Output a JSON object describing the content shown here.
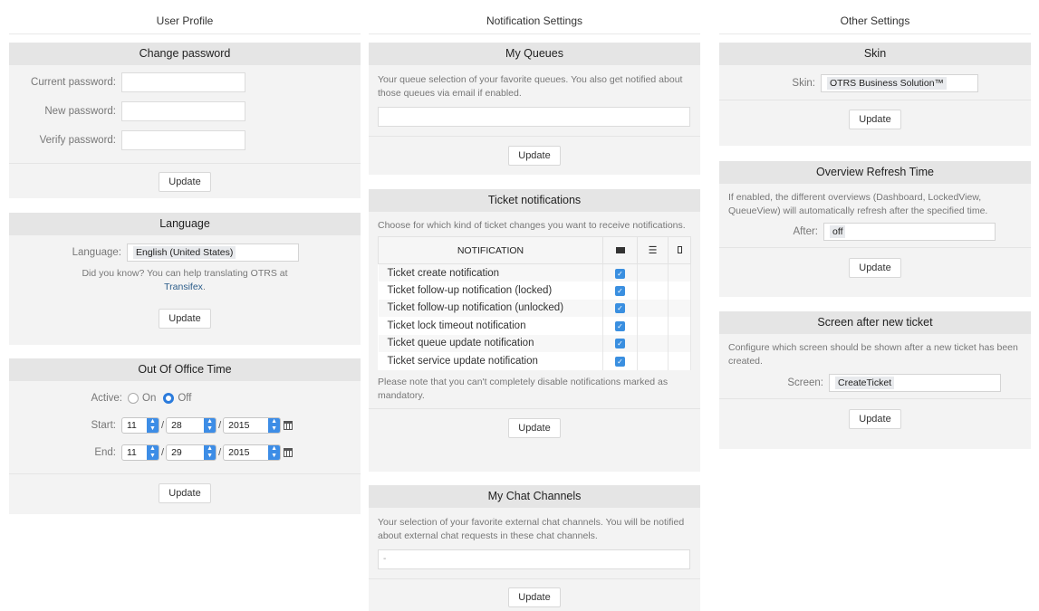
{
  "columns": {
    "user_profile": "User Profile",
    "notification_settings": "Notification Settings",
    "other_settings": "Other Settings"
  },
  "update_label": "Update",
  "change_password": {
    "title": "Change password",
    "current_label": "Current password:",
    "new_label": "New password:",
    "verify_label": "Verify password:"
  },
  "language": {
    "title": "Language",
    "label": "Language:",
    "value": "English (United States)",
    "hint": "Did you know? You can help translating OTRS at",
    "link": "Transifex",
    "hint_end": "."
  },
  "out_of_office": {
    "title": "Out Of Office Time",
    "active_label": "Active:",
    "on_label": "On",
    "off_label": "Off",
    "start_label": "Start:",
    "end_label": "End:",
    "start": {
      "month": "11",
      "day": "28",
      "year": "2015"
    },
    "end": {
      "month": "11",
      "day": "29",
      "year": "2015"
    }
  },
  "my_queues": {
    "title": "My Queues",
    "description": "Your queue selection of your favorite queues. You also get notified about those queues via email if enabled."
  },
  "ticket_notifications": {
    "title": "Ticket notifications",
    "description": "Choose for which kind of ticket changes you want to receive notifications.",
    "header": "NOTIFICATION",
    "rows": [
      "Ticket create notification",
      "Ticket follow-up notification (locked)",
      "Ticket follow-up notification (unlocked)",
      "Ticket lock timeout notification",
      "Ticket queue update notification",
      "Ticket service update notification"
    ],
    "note": "Please note that you can't completely disable notifications marked as mandatory."
  },
  "chat_channels": {
    "title": "My Chat Channels",
    "description": "Your selection of your favorite external chat channels. You will be notified about external chat requests in these chat channels.",
    "value": "-"
  },
  "skin": {
    "title": "Skin",
    "label": "Skin:",
    "value": "OTRS Business Solution™"
  },
  "refresh": {
    "title": "Overview Refresh Time",
    "description": "If enabled, the different overviews (Dashboard, LockedView, QueueView) will automatically refresh after the specified time.",
    "label": "After:",
    "value": "off"
  },
  "screen_after": {
    "title": "Screen after new ticket",
    "description": "Configure which screen should be shown after a new ticket has been created.",
    "label": "Screen:",
    "value": "CreateTicket"
  },
  "colors": {
    "accent": "#3a8fe0",
    "link": "#2c5d8a",
    "card": "#f3f3f3",
    "card_head": "#e5e5e5"
  }
}
